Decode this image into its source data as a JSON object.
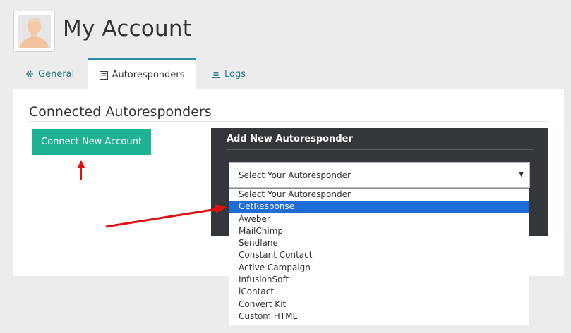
{
  "page": {
    "title": "My Account"
  },
  "tabs": [
    {
      "label": "General",
      "icon": "gear-icon"
    },
    {
      "label": "Autoresponders",
      "icon": "list-icon",
      "active": true
    },
    {
      "label": "Logs",
      "icon": "list-icon"
    }
  ],
  "section": {
    "title": "Connected Autoresponders"
  },
  "connect_button": {
    "label": "Connect New Account"
  },
  "autoresponder_box": {
    "title": "Add New Autoresponder",
    "select_value": "Select Your Autoresponder"
  },
  "dropdown": {
    "options": [
      "Select Your Autoresponder",
      "GetResponse",
      "Aweber",
      "MailChimp",
      "Sendlane",
      "Constant Contact",
      "Active Campaign",
      "InfusionSoft",
      "iContact",
      "Convert Kit",
      "Custom HTML"
    ],
    "highlighted": "GetResponse"
  },
  "colors": {
    "accent_teal": "#1fb194",
    "tab_link": "#2c7c8c",
    "dark_box": "#33363b",
    "highlight": "#1e6cd6",
    "annotation_arrow": "#e01010"
  }
}
